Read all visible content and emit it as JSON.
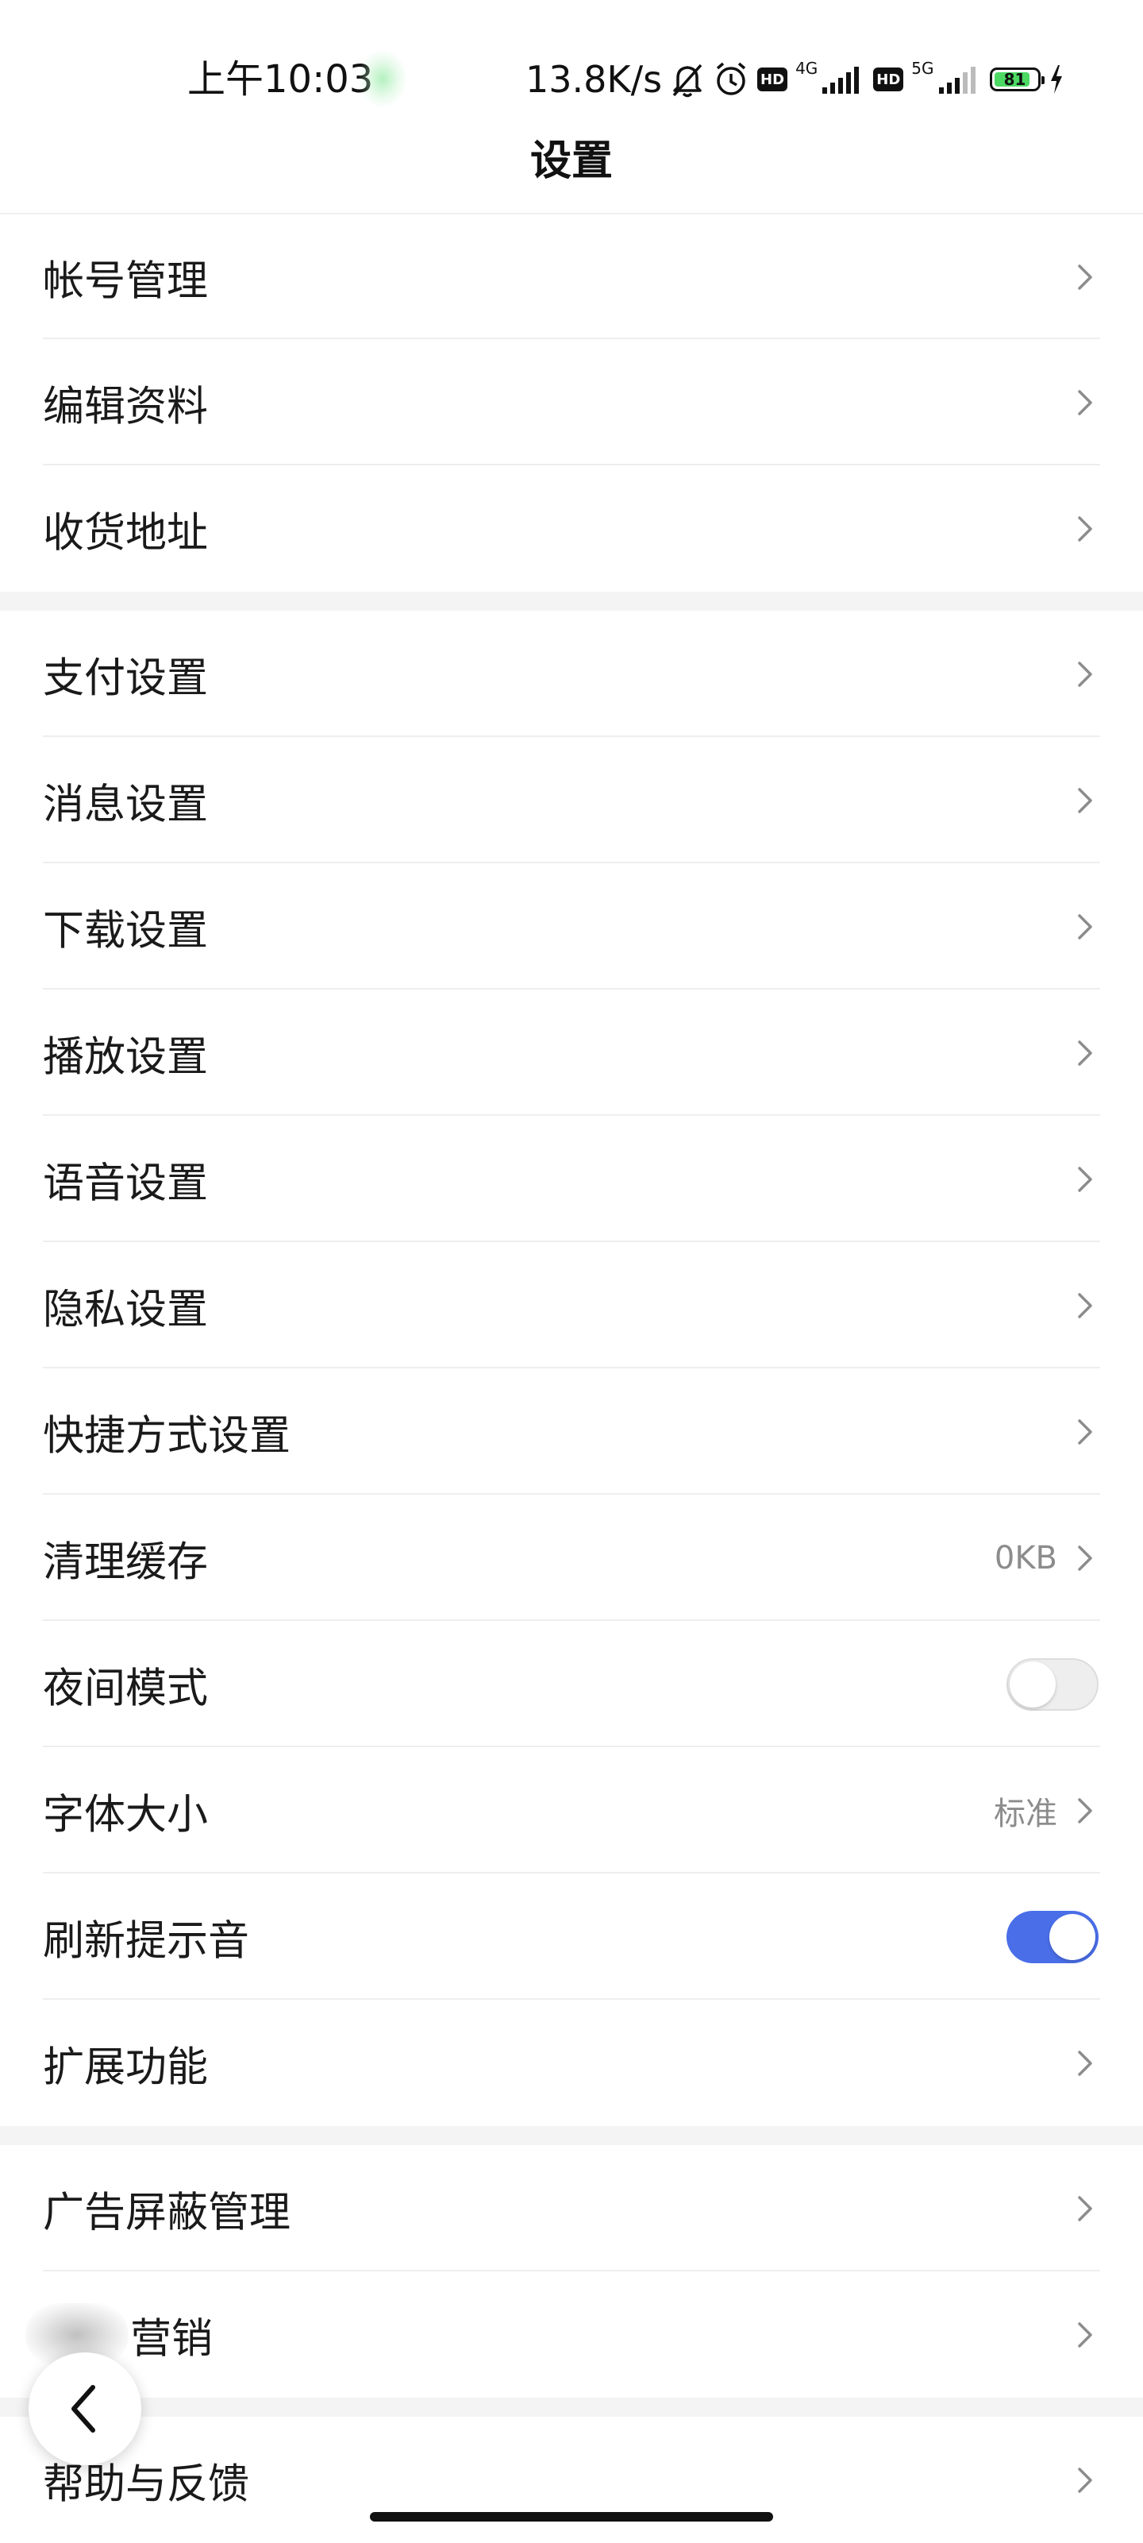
{
  "status_bar": {
    "time": "上午10:03",
    "network_speed": "13.8K/s",
    "net1_type": "4G",
    "net2_type": "5G",
    "hd_label": "HD",
    "battery_level": "81",
    "icons": [
      "bell-muted-icon",
      "alarm-icon",
      "hd-icon",
      "signal-4g-icon",
      "hd-icon",
      "signal-5g-icon",
      "battery-icon",
      "charging-icon"
    ]
  },
  "header": {
    "title": "设置"
  },
  "groups": [
    {
      "items": [
        {
          "label": "帐号管理",
          "type": "link"
        },
        {
          "label": "编辑资料",
          "type": "link"
        },
        {
          "label": "收货地址",
          "type": "link"
        }
      ]
    },
    {
      "items": [
        {
          "label": "支付设置",
          "type": "link"
        },
        {
          "label": "消息设置",
          "type": "link"
        },
        {
          "label": "下载设置",
          "type": "link"
        },
        {
          "label": "播放设置",
          "type": "link"
        },
        {
          "label": "语音设置",
          "type": "link"
        },
        {
          "label": "隐私设置",
          "type": "link"
        },
        {
          "label": "快捷方式设置",
          "type": "link"
        },
        {
          "label": "清理缓存",
          "type": "link",
          "value": "0KB"
        },
        {
          "label": "夜间模式",
          "type": "toggle",
          "on": false
        },
        {
          "label": "字体大小",
          "type": "link",
          "value": "标准"
        },
        {
          "label": "刷新提示音",
          "type": "toggle",
          "on": true
        },
        {
          "label": "扩展功能",
          "type": "link"
        }
      ]
    },
    {
      "items": [
        {
          "label": "广告屏蔽管理",
          "type": "link"
        },
        {
          "label": "营销",
          "type": "link",
          "blurred_prefix": true
        }
      ]
    },
    {
      "items": [
        {
          "label": "帮助与反馈",
          "type": "link"
        }
      ]
    }
  ],
  "colors": {
    "toggle_on": "#4a6ee8",
    "toggle_off": "#eeeeee",
    "value_text": "#8c8c8c",
    "separator": "#eeeeee",
    "group_gap": "#f4f4f4"
  }
}
